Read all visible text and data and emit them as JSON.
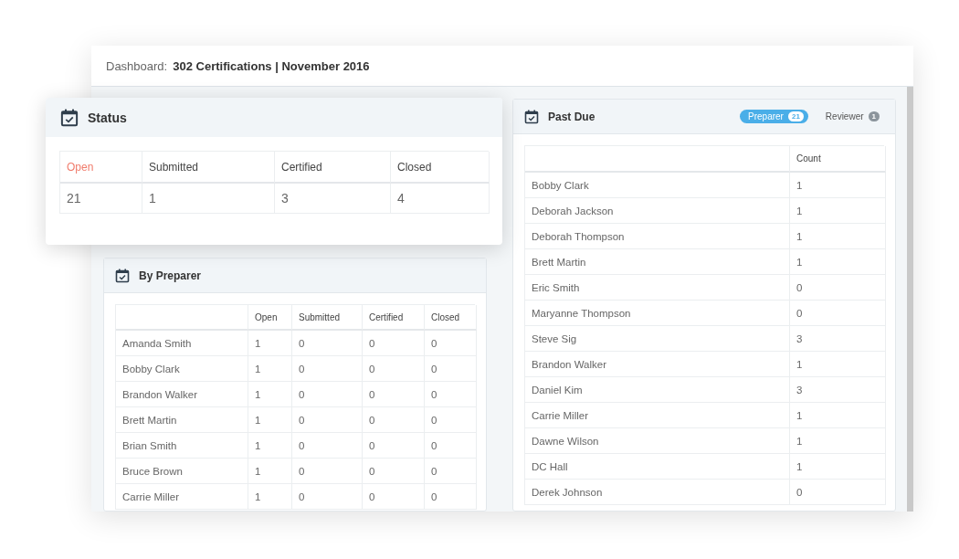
{
  "header": {
    "label": "Dashboard:",
    "title": "302 Certifications | November 2016"
  },
  "status": {
    "title": "Status",
    "columns": [
      {
        "label": "Open",
        "selected": true
      },
      {
        "label": "Submitted",
        "selected": false
      },
      {
        "label": "Certified",
        "selected": false
      },
      {
        "label": "Closed",
        "selected": false
      }
    ],
    "values": [
      "21",
      "1",
      "3",
      "4"
    ]
  },
  "by_preparer": {
    "title": "By Preparer",
    "columns": [
      "Open",
      "Submitted",
      "Certified",
      "Closed"
    ],
    "rows": [
      {
        "name": "Amanda Smith",
        "values": [
          "1",
          "0",
          "0",
          "0"
        ]
      },
      {
        "name": "Bobby Clark",
        "values": [
          "1",
          "0",
          "0",
          "0"
        ]
      },
      {
        "name": "Brandon Walker",
        "values": [
          "1",
          "0",
          "0",
          "0"
        ]
      },
      {
        "name": "Brett Martin",
        "values": [
          "1",
          "0",
          "0",
          "0"
        ]
      },
      {
        "name": "Brian Smith",
        "values": [
          "1",
          "0",
          "0",
          "0"
        ]
      },
      {
        "name": "Bruce Brown",
        "values": [
          "1",
          "0",
          "0",
          "0"
        ]
      },
      {
        "name": "Carrie Miller",
        "values": [
          "1",
          "0",
          "0",
          "0"
        ]
      }
    ]
  },
  "past_due": {
    "title": "Past Due",
    "tabs": [
      {
        "label": "Preparer",
        "count": "21",
        "selected": true
      },
      {
        "label": "Reviewer",
        "count": "1",
        "selected": false
      }
    ],
    "columns": [
      "Count"
    ],
    "rows": [
      {
        "name": "Bobby Clark",
        "count": "1"
      },
      {
        "name": "Deborah Jackson",
        "count": "1"
      },
      {
        "name": "Deborah Thompson",
        "count": "1"
      },
      {
        "name": "Brett Martin",
        "count": "1"
      },
      {
        "name": "Eric Smith",
        "count": "0"
      },
      {
        "name": "Maryanne Thompson",
        "count": "0"
      },
      {
        "name": "Steve Sig",
        "count": "3"
      },
      {
        "name": "Brandon Walker",
        "count": "1"
      },
      {
        "name": "Daniel Kim",
        "count": "3"
      },
      {
        "name": "Carrie Miller",
        "count": "1"
      },
      {
        "name": "Dawne Wilson",
        "count": "1"
      },
      {
        "name": "DC Hall",
        "count": "1"
      },
      {
        "name": "Derek Johnson",
        "count": "0"
      }
    ]
  }
}
